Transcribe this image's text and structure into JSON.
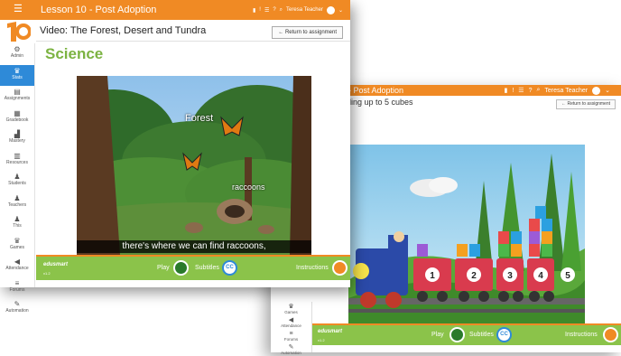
{
  "front": {
    "title": "Lesson 10 - Post Adoption",
    "user": "Teresa Teacher",
    "subtitle": "Video: The Forest, Desert and Tundra",
    "return_label": "Return to assignment",
    "heading": "Science",
    "nav": [
      {
        "label": "Admin",
        "icon": "gear-icon"
      },
      {
        "label": "Stats",
        "icon": "trophy-icon"
      },
      {
        "label": "Assignments",
        "icon": "document-icon"
      },
      {
        "label": "Gradebook",
        "icon": "grid-icon"
      },
      {
        "label": "Mastery",
        "icon": "chart-icon"
      },
      {
        "label": "Resources",
        "icon": "book-icon"
      },
      {
        "label": "Students",
        "icon": "person-icon"
      },
      {
        "label": "Teachers",
        "icon": "person-icon"
      },
      {
        "label": "This",
        "icon": "person-icon"
      },
      {
        "label": "Games",
        "icon": "trophy-icon"
      },
      {
        "label": "Attendance",
        "icon": "megaphone-icon"
      },
      {
        "label": "Forums",
        "icon": "list-icon"
      },
      {
        "label": "Automation",
        "icon": "wrench-icon"
      }
    ],
    "video": {
      "label_forest": "Forest",
      "label_raccoons": "raccoons",
      "caption": "there's where we can find raccoons,"
    },
    "controls": {
      "brand": "edusmart",
      "version": "v1.2",
      "play": "Play",
      "subtitles": "Subtitles",
      "cc": "CC",
      "instructions": "Instructions"
    }
  },
  "back": {
    "title": "- Post Adoption",
    "user": "Teresa Teacher",
    "subtitle": "ding up to 5 cubes",
    "return_label": "Return to assignment",
    "nav": [
      {
        "label": "Games",
        "icon": "trophy-icon"
      },
      {
        "label": "Attendance",
        "icon": "megaphone-icon"
      },
      {
        "label": "Forums",
        "icon": "list-icon"
      },
      {
        "label": "Automation",
        "icon": "wrench-icon"
      }
    ],
    "train_numbers": [
      "1",
      "2",
      "3",
      "4",
      "5"
    ],
    "controls": {
      "brand": "edusmart",
      "version": "v1.2",
      "play": "Play",
      "subtitles": "Subtitles",
      "cc": "CC",
      "instructions": "Instructions"
    }
  },
  "colors": {
    "orange": "#f08a24",
    "green": "#8bc34a",
    "blue": "#2e8ad8",
    "heading_green": "#7cb342"
  }
}
